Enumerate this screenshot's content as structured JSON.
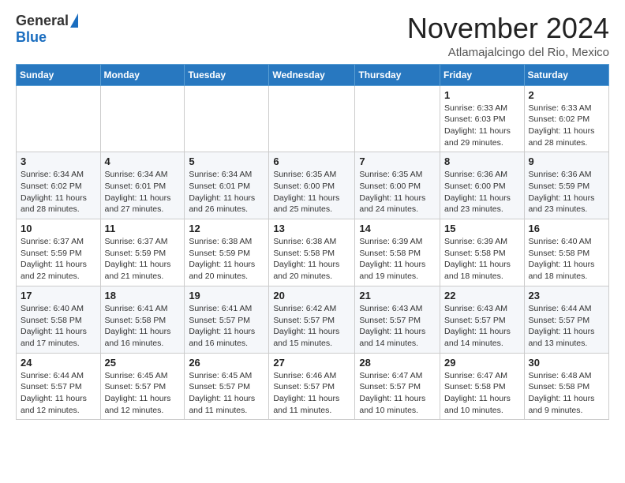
{
  "header": {
    "logo_general": "General",
    "logo_blue": "Blue",
    "month_title": "November 2024",
    "location": "Atlamajalcingo del Rio, Mexico"
  },
  "weekdays": [
    "Sunday",
    "Monday",
    "Tuesday",
    "Wednesday",
    "Thursday",
    "Friday",
    "Saturday"
  ],
  "weeks": [
    [
      {
        "day": "",
        "detail": ""
      },
      {
        "day": "",
        "detail": ""
      },
      {
        "day": "",
        "detail": ""
      },
      {
        "day": "",
        "detail": ""
      },
      {
        "day": "",
        "detail": ""
      },
      {
        "day": "1",
        "detail": "Sunrise: 6:33 AM\nSunset: 6:03 PM\nDaylight: 11 hours and 29 minutes."
      },
      {
        "day": "2",
        "detail": "Sunrise: 6:33 AM\nSunset: 6:02 PM\nDaylight: 11 hours and 28 minutes."
      }
    ],
    [
      {
        "day": "3",
        "detail": "Sunrise: 6:34 AM\nSunset: 6:02 PM\nDaylight: 11 hours and 28 minutes."
      },
      {
        "day": "4",
        "detail": "Sunrise: 6:34 AM\nSunset: 6:01 PM\nDaylight: 11 hours and 27 minutes."
      },
      {
        "day": "5",
        "detail": "Sunrise: 6:34 AM\nSunset: 6:01 PM\nDaylight: 11 hours and 26 minutes."
      },
      {
        "day": "6",
        "detail": "Sunrise: 6:35 AM\nSunset: 6:00 PM\nDaylight: 11 hours and 25 minutes."
      },
      {
        "day": "7",
        "detail": "Sunrise: 6:35 AM\nSunset: 6:00 PM\nDaylight: 11 hours and 24 minutes."
      },
      {
        "day": "8",
        "detail": "Sunrise: 6:36 AM\nSunset: 6:00 PM\nDaylight: 11 hours and 23 minutes."
      },
      {
        "day": "9",
        "detail": "Sunrise: 6:36 AM\nSunset: 5:59 PM\nDaylight: 11 hours and 23 minutes."
      }
    ],
    [
      {
        "day": "10",
        "detail": "Sunrise: 6:37 AM\nSunset: 5:59 PM\nDaylight: 11 hours and 22 minutes."
      },
      {
        "day": "11",
        "detail": "Sunrise: 6:37 AM\nSunset: 5:59 PM\nDaylight: 11 hours and 21 minutes."
      },
      {
        "day": "12",
        "detail": "Sunrise: 6:38 AM\nSunset: 5:59 PM\nDaylight: 11 hours and 20 minutes."
      },
      {
        "day": "13",
        "detail": "Sunrise: 6:38 AM\nSunset: 5:58 PM\nDaylight: 11 hours and 20 minutes."
      },
      {
        "day": "14",
        "detail": "Sunrise: 6:39 AM\nSunset: 5:58 PM\nDaylight: 11 hours and 19 minutes."
      },
      {
        "day": "15",
        "detail": "Sunrise: 6:39 AM\nSunset: 5:58 PM\nDaylight: 11 hours and 18 minutes."
      },
      {
        "day": "16",
        "detail": "Sunrise: 6:40 AM\nSunset: 5:58 PM\nDaylight: 11 hours and 18 minutes."
      }
    ],
    [
      {
        "day": "17",
        "detail": "Sunrise: 6:40 AM\nSunset: 5:58 PM\nDaylight: 11 hours and 17 minutes."
      },
      {
        "day": "18",
        "detail": "Sunrise: 6:41 AM\nSunset: 5:58 PM\nDaylight: 11 hours and 16 minutes."
      },
      {
        "day": "19",
        "detail": "Sunrise: 6:41 AM\nSunset: 5:57 PM\nDaylight: 11 hours and 16 minutes."
      },
      {
        "day": "20",
        "detail": "Sunrise: 6:42 AM\nSunset: 5:57 PM\nDaylight: 11 hours and 15 minutes."
      },
      {
        "day": "21",
        "detail": "Sunrise: 6:43 AM\nSunset: 5:57 PM\nDaylight: 11 hours and 14 minutes."
      },
      {
        "day": "22",
        "detail": "Sunrise: 6:43 AM\nSunset: 5:57 PM\nDaylight: 11 hours and 14 minutes."
      },
      {
        "day": "23",
        "detail": "Sunrise: 6:44 AM\nSunset: 5:57 PM\nDaylight: 11 hours and 13 minutes."
      }
    ],
    [
      {
        "day": "24",
        "detail": "Sunrise: 6:44 AM\nSunset: 5:57 PM\nDaylight: 11 hours and 12 minutes."
      },
      {
        "day": "25",
        "detail": "Sunrise: 6:45 AM\nSunset: 5:57 PM\nDaylight: 11 hours and 12 minutes."
      },
      {
        "day": "26",
        "detail": "Sunrise: 6:45 AM\nSunset: 5:57 PM\nDaylight: 11 hours and 11 minutes."
      },
      {
        "day": "27",
        "detail": "Sunrise: 6:46 AM\nSunset: 5:57 PM\nDaylight: 11 hours and 11 minutes."
      },
      {
        "day": "28",
        "detail": "Sunrise: 6:47 AM\nSunset: 5:57 PM\nDaylight: 11 hours and 10 minutes."
      },
      {
        "day": "29",
        "detail": "Sunrise: 6:47 AM\nSunset: 5:58 PM\nDaylight: 11 hours and 10 minutes."
      },
      {
        "day": "30",
        "detail": "Sunrise: 6:48 AM\nSunset: 5:58 PM\nDaylight: 11 hours and 9 minutes."
      }
    ]
  ]
}
